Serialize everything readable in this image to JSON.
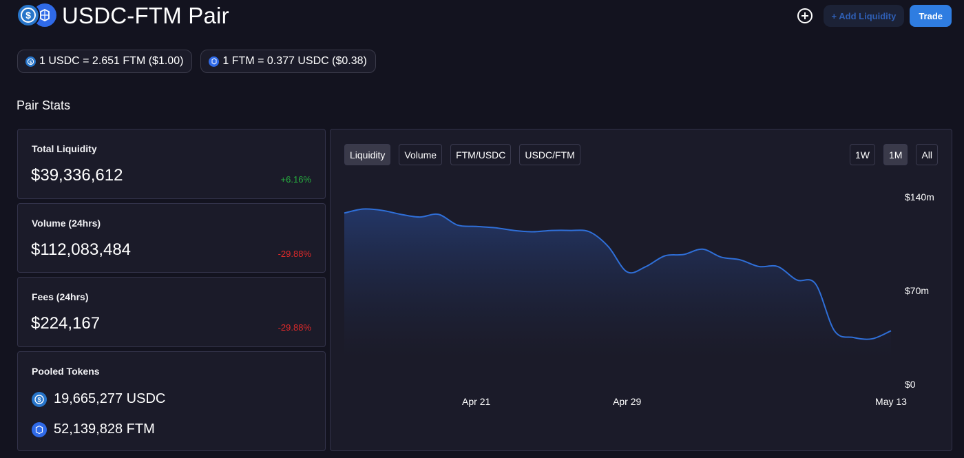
{
  "header": {
    "title": "USDC-FTM Pair",
    "add_liquidity_label": "+ Add Liquidity",
    "trade_label": "Trade"
  },
  "prices": {
    "usdc_rate": "1 USDC = 2.651 FTM ($1.00)",
    "ftm_rate": "1 FTM = 0.377 USDC ($0.38)"
  },
  "pair_stats": {
    "title": "Pair Stats",
    "total_liquidity": {
      "label": "Total Liquidity",
      "value": "$39,336,612",
      "change": "+6.16%"
    },
    "volume": {
      "label": "Volume (24hrs)",
      "value": "$112,083,484",
      "change": "-29.88%"
    },
    "fees": {
      "label": "Fees (24hrs)",
      "value": "$224,167",
      "change": "-29.88%"
    },
    "pooled_tokens": {
      "label": "Pooled Tokens",
      "usdc": "19,665,277 USDC",
      "ftm": "52,139,828 FTM"
    }
  },
  "chart_tabs": [
    "Liquidity",
    "Volume",
    "FTM/USDC",
    "USDC/FTM"
  ],
  "range_tabs": [
    "1W",
    "1M",
    "All"
  ],
  "active_chart_tab": "Liquidity",
  "active_range_tab": "1M",
  "colors": {
    "accent": "#2f7de1",
    "positive": "#27ae3f",
    "negative": "#e02a2a",
    "line": "#2f6fd8"
  },
  "icons": [
    "usdc-token-icon",
    "ftm-token-icon",
    "add-circle-icon"
  ],
  "chart_data": {
    "type": "area",
    "title": "",
    "xlabel": "",
    "ylabel": "",
    "x_ticks": [
      "Apr 21",
      "Apr 29",
      "May 13"
    ],
    "y_ticks": [
      "$0",
      "$70m",
      "$140m"
    ],
    "ylim": [
      0,
      140
    ],
    "y_unit": "$m",
    "x": [
      "Apr 14",
      "Apr 15",
      "Apr 16",
      "Apr 17",
      "Apr 18",
      "Apr 19",
      "Apr 20",
      "Apr 21",
      "Apr 22",
      "Apr 23",
      "Apr 24",
      "Apr 25",
      "Apr 26",
      "Apr 27",
      "Apr 28",
      "Apr 29",
      "Apr 30",
      "May 1",
      "May 2",
      "May 3",
      "May 4",
      "May 5",
      "May 6",
      "May 7",
      "May 8",
      "May 9",
      "May 10",
      "May 11",
      "May 12",
      "May 13"
    ],
    "values": [
      128,
      131,
      130,
      127,
      125,
      127,
      119,
      118,
      117,
      115,
      114,
      115,
      115,
      114,
      103,
      84,
      88,
      96,
      97,
      101,
      95,
      93,
      88,
      88,
      78,
      75,
      40,
      35,
      34,
      40
    ],
    "grid": false,
    "legend": "none"
  }
}
